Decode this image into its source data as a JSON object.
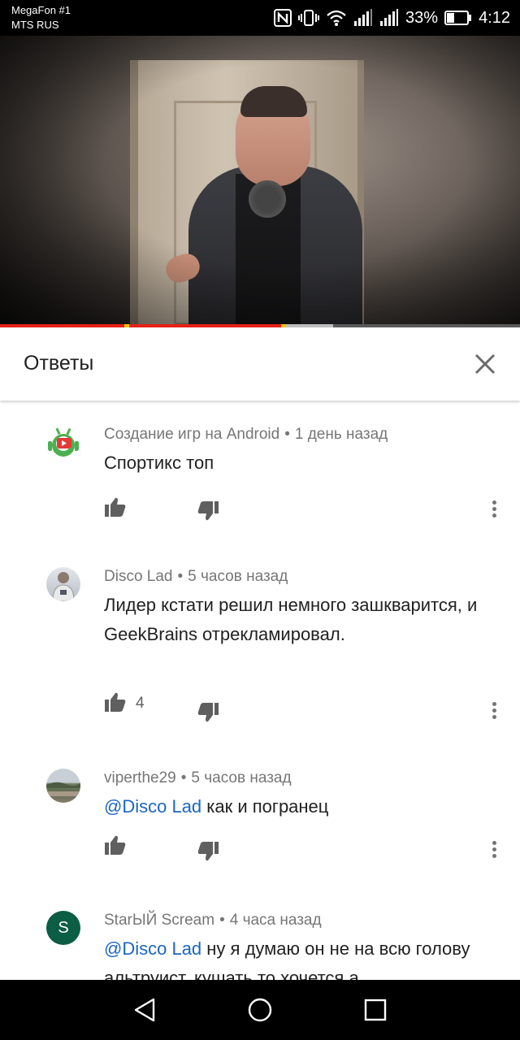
{
  "status_bar": {
    "carrier_line1": "MegaFon #1",
    "carrier_line2": "MTS RUS",
    "battery": "33%",
    "time": "4:12",
    "icons": [
      "nfc-icon",
      "vibrate-icon",
      "wifi-icon",
      "signal-icon",
      "signal-icon",
      "battery-icon"
    ]
  },
  "video": {
    "progress_fraction": 0.54,
    "buffer_fraction": 0.64,
    "progress_color": "#e62117",
    "ad_marker_color": "#f7c600"
  },
  "panel": {
    "title": "Ответы",
    "close_icon": "close-icon"
  },
  "comments": [
    {
      "author": "Создание игр на Android",
      "time": "1 день назад",
      "text": "Спортикс топ",
      "likes": "",
      "avatar": "android-youtube-logo"
    },
    {
      "author": "Disco Lad",
      "time": "5 часов назад",
      "text": "Лидер кстати решил немного зашкварится,  и GeekBrains отрекламировал.",
      "likes": "4",
      "avatar": "photo"
    },
    {
      "author": "viperthe29",
      "time": "5 часов назад",
      "mention": "@Disco Lad",
      "text": " как и погранец",
      "likes": "",
      "avatar": "landscape-photo"
    },
    {
      "author": "StarЫЙ Scream",
      "time": "4 часа назад",
      "mention": "@Disco Lad",
      "text": " ну я думаю он не на всю голову альтруист, кушать то хочется а",
      "likes": "",
      "avatar_letter": "S",
      "avatar_color": "#0b5d44"
    }
  ],
  "nav_bar": {
    "icons": [
      "back-icon",
      "home-icon",
      "recents-icon"
    ]
  }
}
